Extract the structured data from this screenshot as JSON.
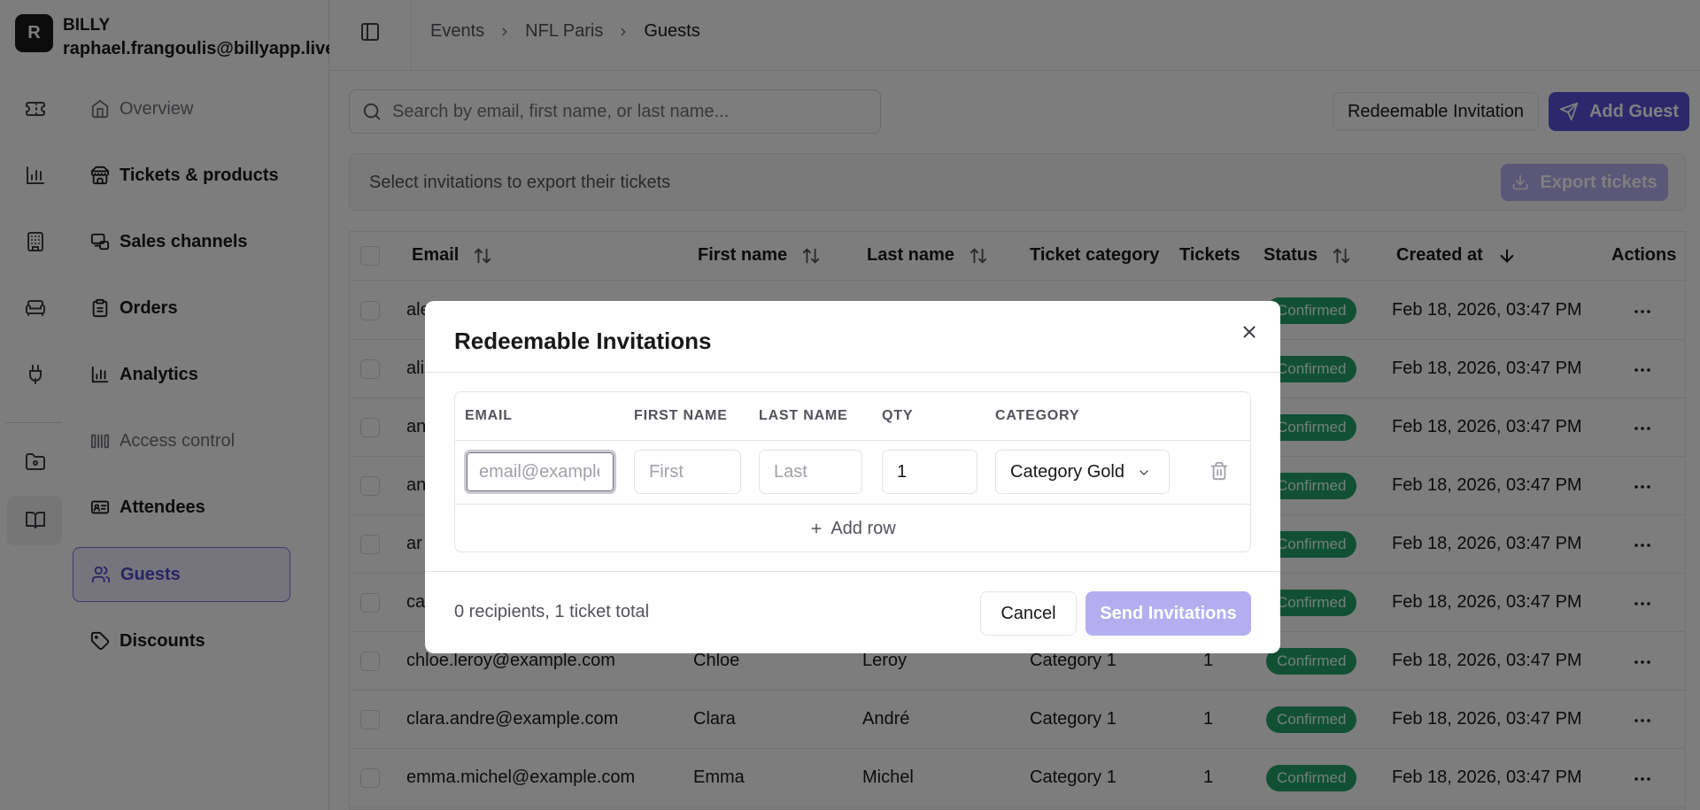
{
  "brand": {
    "initial": "R",
    "name": "BILLY",
    "email": "raphael.frangoulis@billyapp.live"
  },
  "rail_icons": [
    "ticket-icon",
    "bar-chart-icon",
    "building-icon",
    "sofa-icon",
    "plug-icon",
    "folder-icon",
    "book-icon"
  ],
  "nav": [
    {
      "label": "Overview",
      "icon": "home-icon"
    },
    {
      "label": "Tickets & products",
      "icon": "store-icon"
    },
    {
      "label": "Sales channels",
      "icon": "channels-icon"
    },
    {
      "label": "Orders",
      "icon": "clipboard-icon"
    },
    {
      "label": "Analytics",
      "icon": "chart-icon"
    },
    {
      "label": "Access control",
      "icon": "turnstile-icon"
    },
    {
      "label": "Attendees",
      "icon": "id-card-icon"
    },
    {
      "label": "Guests",
      "icon": "users-icon"
    },
    {
      "label": "Discounts",
      "icon": "tag-icon"
    }
  ],
  "breadcrumb": [
    "Events",
    "NFL Paris",
    "Guests"
  ],
  "search": {
    "placeholder": "Search by email, first name, or last name..."
  },
  "buttons": {
    "redeemable": "Redeemable Invitation",
    "add_guest": "Add Guest",
    "export": "Export tickets"
  },
  "export_hint": "Select invitations to export their tickets",
  "table": {
    "headers": [
      "Email",
      "First name",
      "Last name",
      "Ticket category",
      "Tickets",
      "Status",
      "Created at",
      "Actions"
    ],
    "rows": [
      {
        "email": "ale",
        "first": "",
        "last": "",
        "category": "",
        "tickets": "",
        "status": "Confirmed",
        "created": "Feb 18, 2026, 03:47 PM"
      },
      {
        "email": "ali",
        "first": "",
        "last": "",
        "category": "",
        "tickets": "",
        "status": "Confirmed",
        "created": "Feb 18, 2026, 03:47 PM"
      },
      {
        "email": "an",
        "first": "",
        "last": "",
        "category": "",
        "tickets": "",
        "status": "Confirmed",
        "created": "Feb 18, 2026, 03:47 PM"
      },
      {
        "email": "an",
        "first": "",
        "last": "",
        "category": "",
        "tickets": "",
        "status": "Confirmed",
        "created": "Feb 18, 2026, 03:47 PM"
      },
      {
        "email": "ar",
        "first": "",
        "last": "",
        "category": "",
        "tickets": "",
        "status": "Confirmed",
        "created": "Feb 18, 2026, 03:47 PM"
      },
      {
        "email": "ca",
        "first": "",
        "last": "",
        "category": "",
        "tickets": "",
        "status": "Confirmed",
        "created": "Feb 18, 2026, 03:47 PM"
      },
      {
        "email": "chloe.leroy@example.com",
        "first": "Chloe",
        "last": "Leroy",
        "category": "Category 1",
        "tickets": "1",
        "status": "Confirmed",
        "created": "Feb 18, 2026, 03:47 PM"
      },
      {
        "email": "clara.andre@example.com",
        "first": "Clara",
        "last": "André",
        "category": "Category 1",
        "tickets": "1",
        "status": "Confirmed",
        "created": "Feb 18, 2026, 03:47 PM"
      },
      {
        "email": "emma.michel@example.com",
        "first": "Emma",
        "last": "Michel",
        "category": "Category 1",
        "tickets": "1",
        "status": "Confirmed",
        "created": "Feb 18, 2026, 03:47 PM"
      }
    ]
  },
  "modal": {
    "title": "Redeemable Invitations",
    "columns": [
      "EMAIL",
      "FIRST NAME",
      "LAST NAME",
      "QTY",
      "CATEGORY"
    ],
    "row": {
      "email_placeholder": "email@example.com",
      "first_placeholder": "First",
      "last_placeholder": "Last",
      "qty": "1",
      "category": "Category Gold"
    },
    "add_row": "Add row",
    "summary": "0 recipients, 1 ticket total",
    "cancel": "Cancel",
    "send": "Send Invitations"
  },
  "colors": {
    "accent": "#5b51d6",
    "accent_disabled": "#b4aef0",
    "status_confirmed": "#22a06b"
  }
}
